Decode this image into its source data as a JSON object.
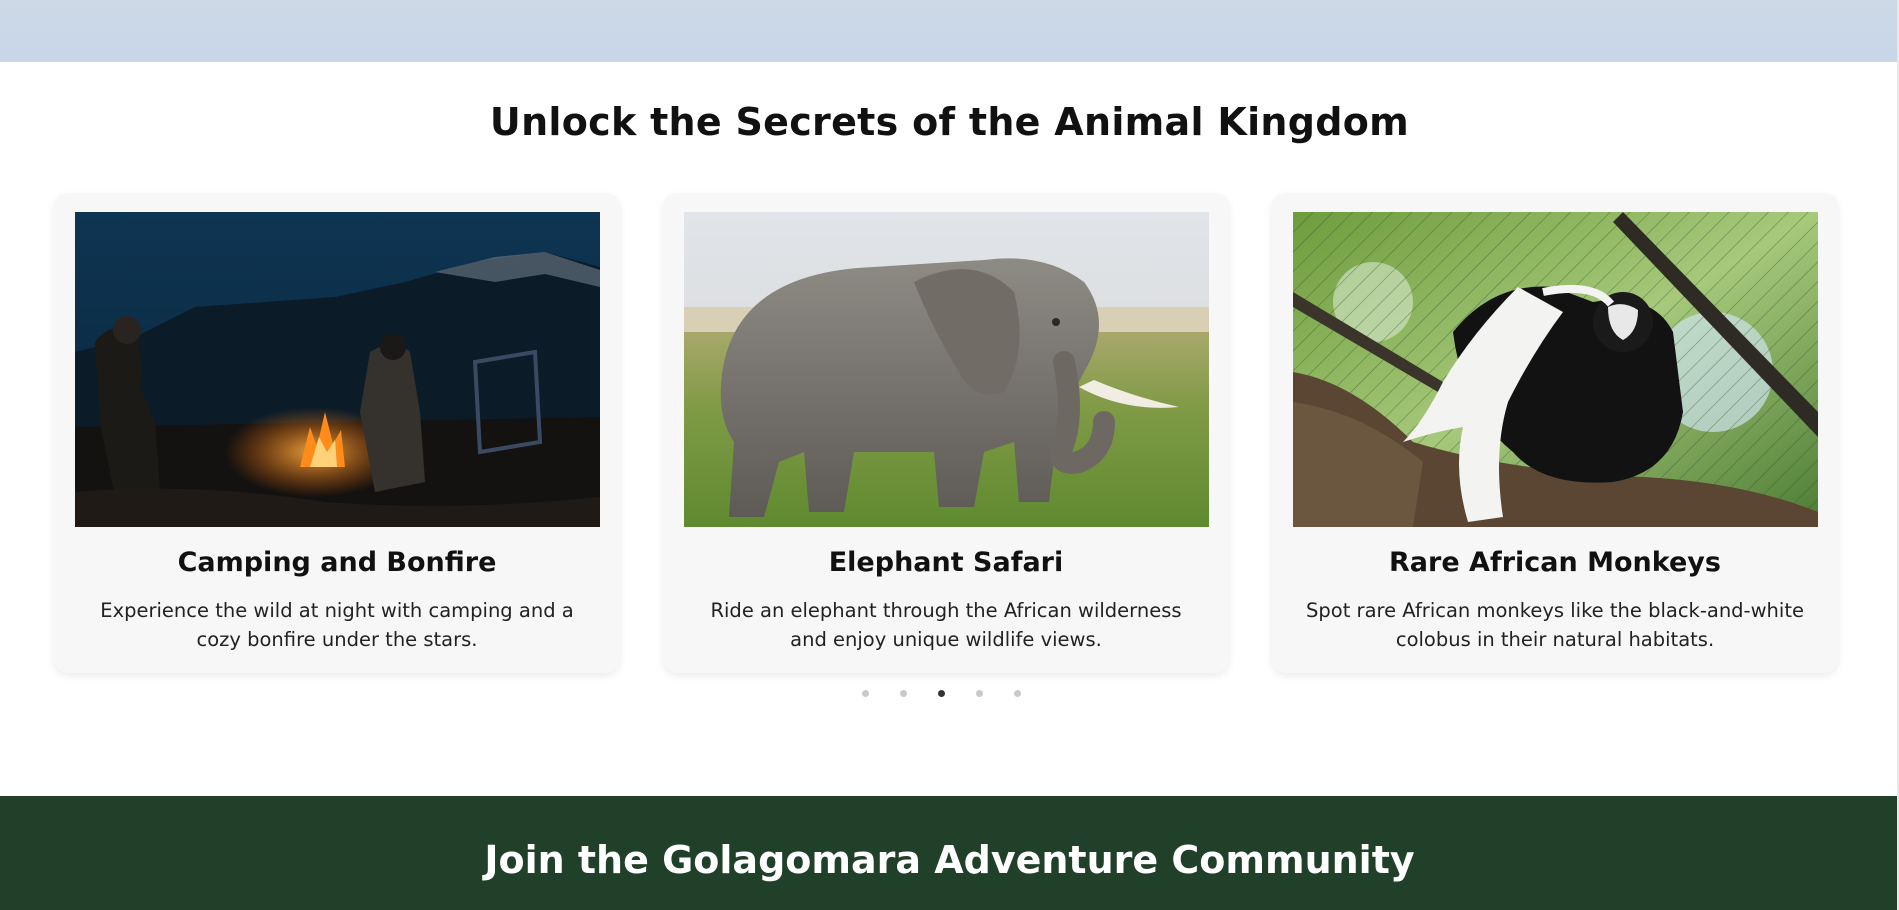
{
  "section": {
    "title": "Unlock the Secrets of the Animal Kingdom"
  },
  "cards": [
    {
      "title": "Camping and Bonfire",
      "description": "Experience the wild at night with camping and a cozy bonfire under the stars.",
      "image_icon": "campfire-photo"
    },
    {
      "title": "Elephant Safari",
      "description": "Ride an elephant through the African wilderness and enjoy unique wildlife views.",
      "image_icon": "elephant-photo"
    },
    {
      "title": "Rare African Monkeys",
      "description": "Spot rare African monkeys like the black-and-white colobus in their natural habitats.",
      "image_icon": "colobus-monkey-photo"
    }
  ],
  "carousel": {
    "slide_count": 5,
    "active_index": 2
  },
  "footer": {
    "title": "Join the Golagomara Adventure Community"
  },
  "colors": {
    "top_band": "#c8d6e8",
    "card_bg": "#f7f7f7",
    "footer_bg": "#21402a",
    "dot_active": "#333333",
    "dot_inactive": "#c9c9c9"
  }
}
